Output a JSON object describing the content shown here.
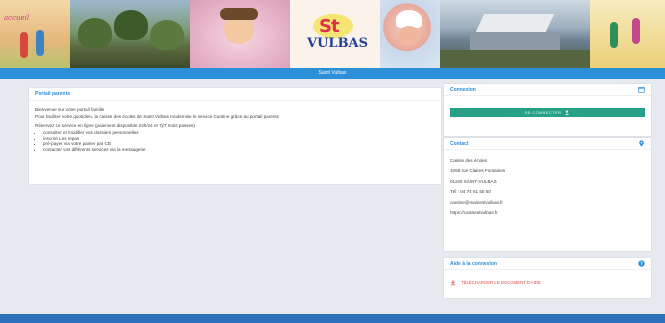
{
  "banner": {
    "corner_word": "accueil",
    "logo_st": "St",
    "logo_vulbas": "VULBAS"
  },
  "topbar": {
    "title": "Saint Vulbas"
  },
  "portal": {
    "title": "Portail parents",
    "welcome": "Bienvenue sur votre portail famille",
    "intro": "Pour faciliter votre quotidien, la caisse des écoles de Saint Vulbas modernise le service Cantine grâce au portail parents",
    "subtitle": "Réservez ce service en ligne (paiement disponible 24h/24 et 7j/7 mois passes)",
    "items": [
      "consulter et modifier vos dossiers personnelles",
      "inscrire Les repas",
      "pré-payer via votre panier par CB",
      "contacter vos différents services via la messagerie"
    ]
  },
  "connexion": {
    "title": "Connexion",
    "icon": "calendar-icon",
    "button_label": "SE CONNECTER"
  },
  "contact": {
    "title": "Contact",
    "icon": "map-pin-icon",
    "lines": [
      "Caisse des écoles",
      "1058 rue Claires Fontaines",
      "01150 SAINT-VULBAS",
      "Tél : 04 74 61 50 50",
      "cantine@mairiestvulbas.fr",
      "https://caissestvulbas.fr"
    ]
  },
  "help": {
    "title": "Aide à la connexion",
    "icon": "help-circle-icon",
    "link_label": "TÉLÉCHARGER LE DOCUMENT D'AIDE",
    "link_icon": "download-icon"
  },
  "colors": {
    "accent": "#2c8fd8",
    "button": "#27a089",
    "link": "#e24b4b",
    "footer": "#2c6fba",
    "background": "#e6e9ee"
  }
}
